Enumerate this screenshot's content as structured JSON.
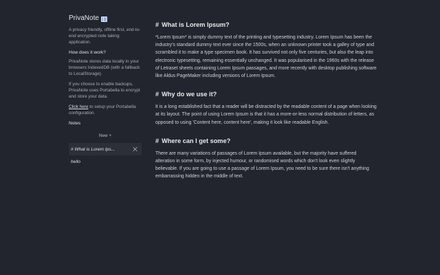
{
  "sidebar": {
    "app_name": "PrivaNote",
    "tagline": "A privacy friendly, offline first, end-to-end encrypted note taking application.",
    "how_heading": "How does it work?",
    "how_text": "PrivaNote stores data locally in your browsers IndexedDB (with a fallback to LocalStorage).",
    "backup_text": "If you choose to enable backups, PrivaNote uses Portabella to encrypt and store your data.",
    "setup_link": "Click here",
    "setup_text": " to setup your Portabella configuration.",
    "notes_heading": "Notes",
    "new_label": "New +",
    "notes": [
      {
        "title": "# What is Lorem Ips..."
      },
      {
        "title": "hello"
      }
    ]
  },
  "main": {
    "sections": [
      {
        "hash": "#",
        "heading": "What is Lorem Ipsum?",
        "body": "*Lorem Ipsum* is simply dummy text of the printing and typesetting industry. Lorem Ipsum has been the industry's standard dummy text ever since the 1500s, when an unknown printer took a galley of type and scrambled it to make a type specimen book. It has survived not only five centuries, but also the leap into electronic typesetting, remaining essentially unchanged. It was popularised in the 1960s with the release of Letraset sheets containing Lorem Ipsum passages, and more recently with desktop publishing software like Aldus PageMaker including versions of Lorem Ipsum."
      },
      {
        "hash": "#",
        "heading": "Why do we use it?",
        "body": "It is a long established fact that a reader will be distracted by the readable content of a page when looking at its layout. The point of using Lorem Ipsum is that it has a more-or-less normal distribution of letters, as opposed to using 'Content here, content here', making it look like readable English."
      },
      {
        "hash": "#",
        "heading": "Where can I get some?",
        "body": "There are many variations of passages of Lorem Ipsum available, but the majority have suffered alteration in some form, by injected humour, or randomised words which don't look even slightly believable. If you are going to use a passage of Lorem Ipsum, you need to be sure there isn't anything embarrassing hidden in the middle of text."
      }
    ]
  }
}
